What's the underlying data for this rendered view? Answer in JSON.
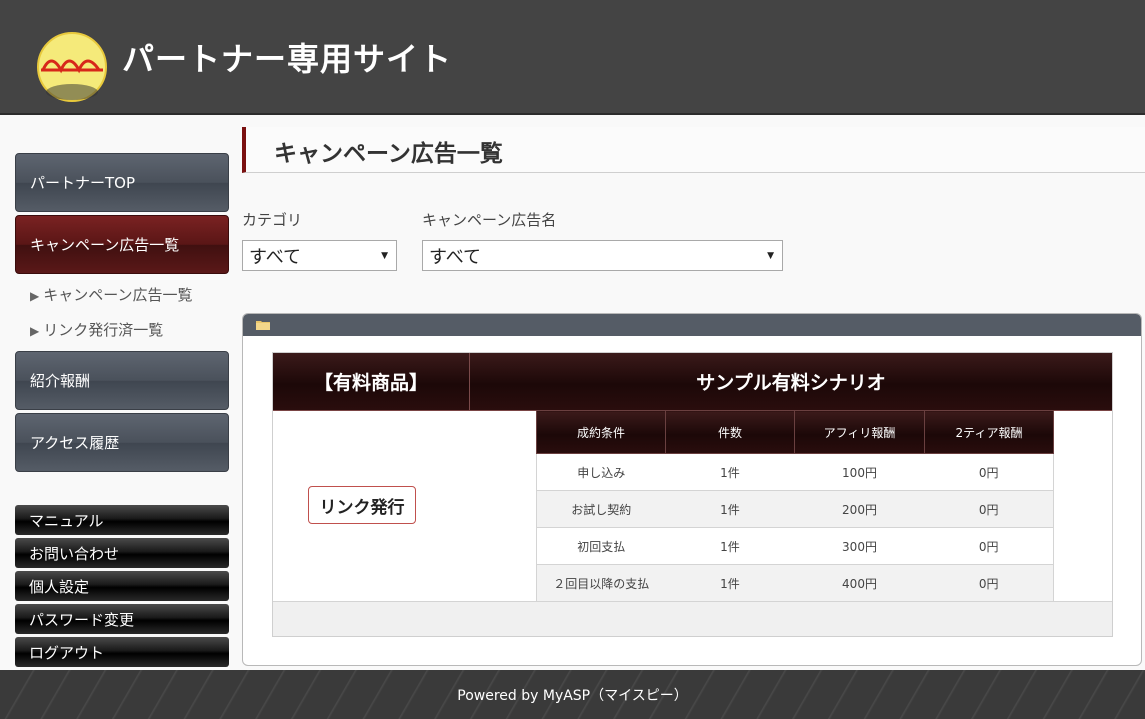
{
  "header": {
    "site_title": "パートナー専用サイト"
  },
  "sidebar": {
    "nav": [
      {
        "label": "パートナーTOP"
      },
      {
        "label": "キャンペーン広告一覧"
      },
      {
        "label": "紹介報酬"
      },
      {
        "label": "アクセス履歴"
      }
    ],
    "sub_items": [
      {
        "label": "キャンペーン広告一覧"
      },
      {
        "label": "リンク発行済一覧"
      }
    ],
    "buttons": [
      {
        "label": "マニュアル"
      },
      {
        "label": "お問い合わせ"
      },
      {
        "label": "個人設定"
      },
      {
        "label": "パスワード変更"
      },
      {
        "label": "ログアウト"
      }
    ]
  },
  "main": {
    "page_title": "キャンペーン広告一覧",
    "filters": {
      "category_label": "カテゴリ",
      "category_value": "すべて",
      "campaign_label": "キャンペーン広告名",
      "campaign_value": "すべて"
    },
    "product": {
      "category": "【有料商品】",
      "name": "サンプル有料シナリオ",
      "issue_button": "リンク発行",
      "columns": [
        "成約条件",
        "件数",
        "アフィリ報酬",
        "2ティア報酬"
      ],
      "rows": [
        [
          "申し込み",
          "1件",
          "100円",
          "0円"
        ],
        [
          "お試し契約",
          "1件",
          "200円",
          "0円"
        ],
        [
          "初回支払",
          "1件",
          "300円",
          "0円"
        ],
        [
          "２回目以降の支払",
          "1件",
          "400円",
          "0円"
        ]
      ]
    }
  },
  "footer": {
    "text": "Powered by MyASP（マイスピー）"
  },
  "icons": {
    "logo": "asp-logo-icon",
    "folder": "folder-icon",
    "dropdown": "dropdown-arrow-icon"
  },
  "colors": {
    "accent": "#7a1010",
    "header": "#444444",
    "sidebar": "#4a515b"
  }
}
